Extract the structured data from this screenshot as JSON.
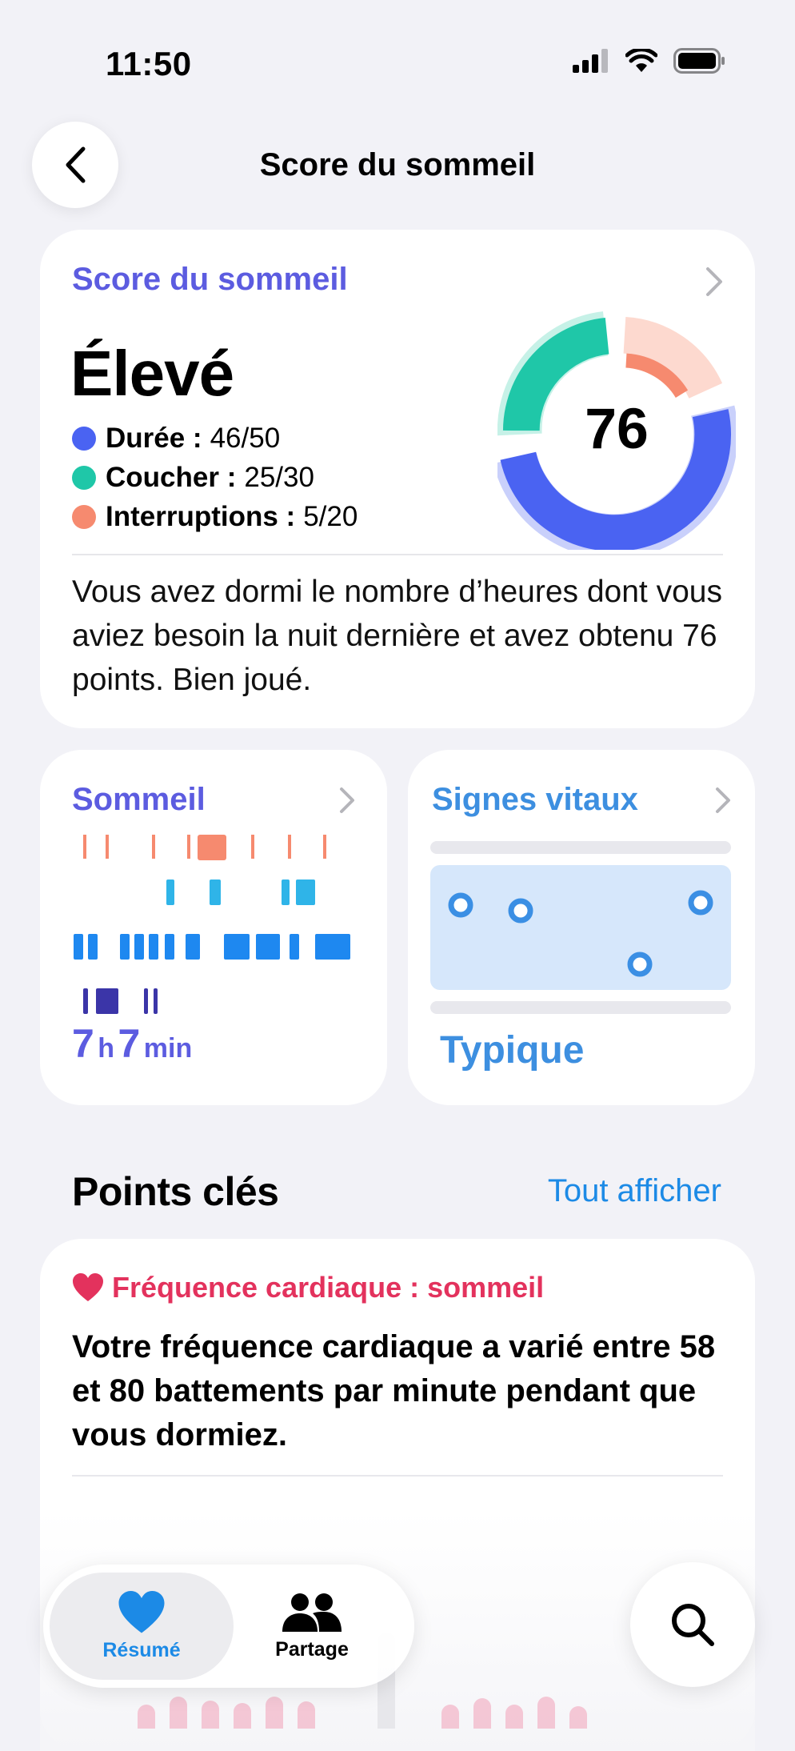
{
  "status_bar": {
    "time": "11:50"
  },
  "nav": {
    "title": "Score du sommeil"
  },
  "score_card": {
    "label": "Score du sommeil",
    "level": "Élevé",
    "score": "76",
    "components": [
      {
        "name": "Durée :",
        "value": "46/50",
        "color": "#4a63f2"
      },
      {
        "name": "Coucher :",
        "value": "25/30",
        "color": "#1fc7a8"
      },
      {
        "name": "Interruptions :",
        "value": "5/20",
        "color": "#f68a6f"
      }
    ],
    "description": "Vous avez dormi le nombre d’heures dont vous aviez besoin la nuit dernière et avez obtenu 76 points. Bien joué."
  },
  "sleep_card": {
    "title": "Sommeil",
    "hours": "7",
    "hours_unit": "h",
    "minutes": "7",
    "minutes_unit": "min"
  },
  "vitals_card": {
    "title": "Signes vitaux",
    "status": "Typique"
  },
  "highlights": {
    "title": "Points clés",
    "link": "Tout afficher",
    "card": {
      "category": "Fréquence cardiaque : sommeil",
      "text": "Votre fréquence cardiaque a varié entre 58 et 80 battements par minute pendant que vous dormiez."
    }
  },
  "tab_bar": {
    "tabs": [
      {
        "label": "Résumé",
        "icon": "heart-icon",
        "selected": true
      },
      {
        "label": "Partage",
        "icon": "people-icon",
        "selected": false
      }
    ],
    "search_icon": "search-icon"
  },
  "colors": {
    "accent_purple": "#5c5ce0",
    "accent_blue": "#1c8ae6",
    "heart_red": "#e3325d",
    "duration_blue": "#4a63f2",
    "bedtime_green": "#1fc7a8",
    "interruptions_orange": "#f68a6f"
  }
}
